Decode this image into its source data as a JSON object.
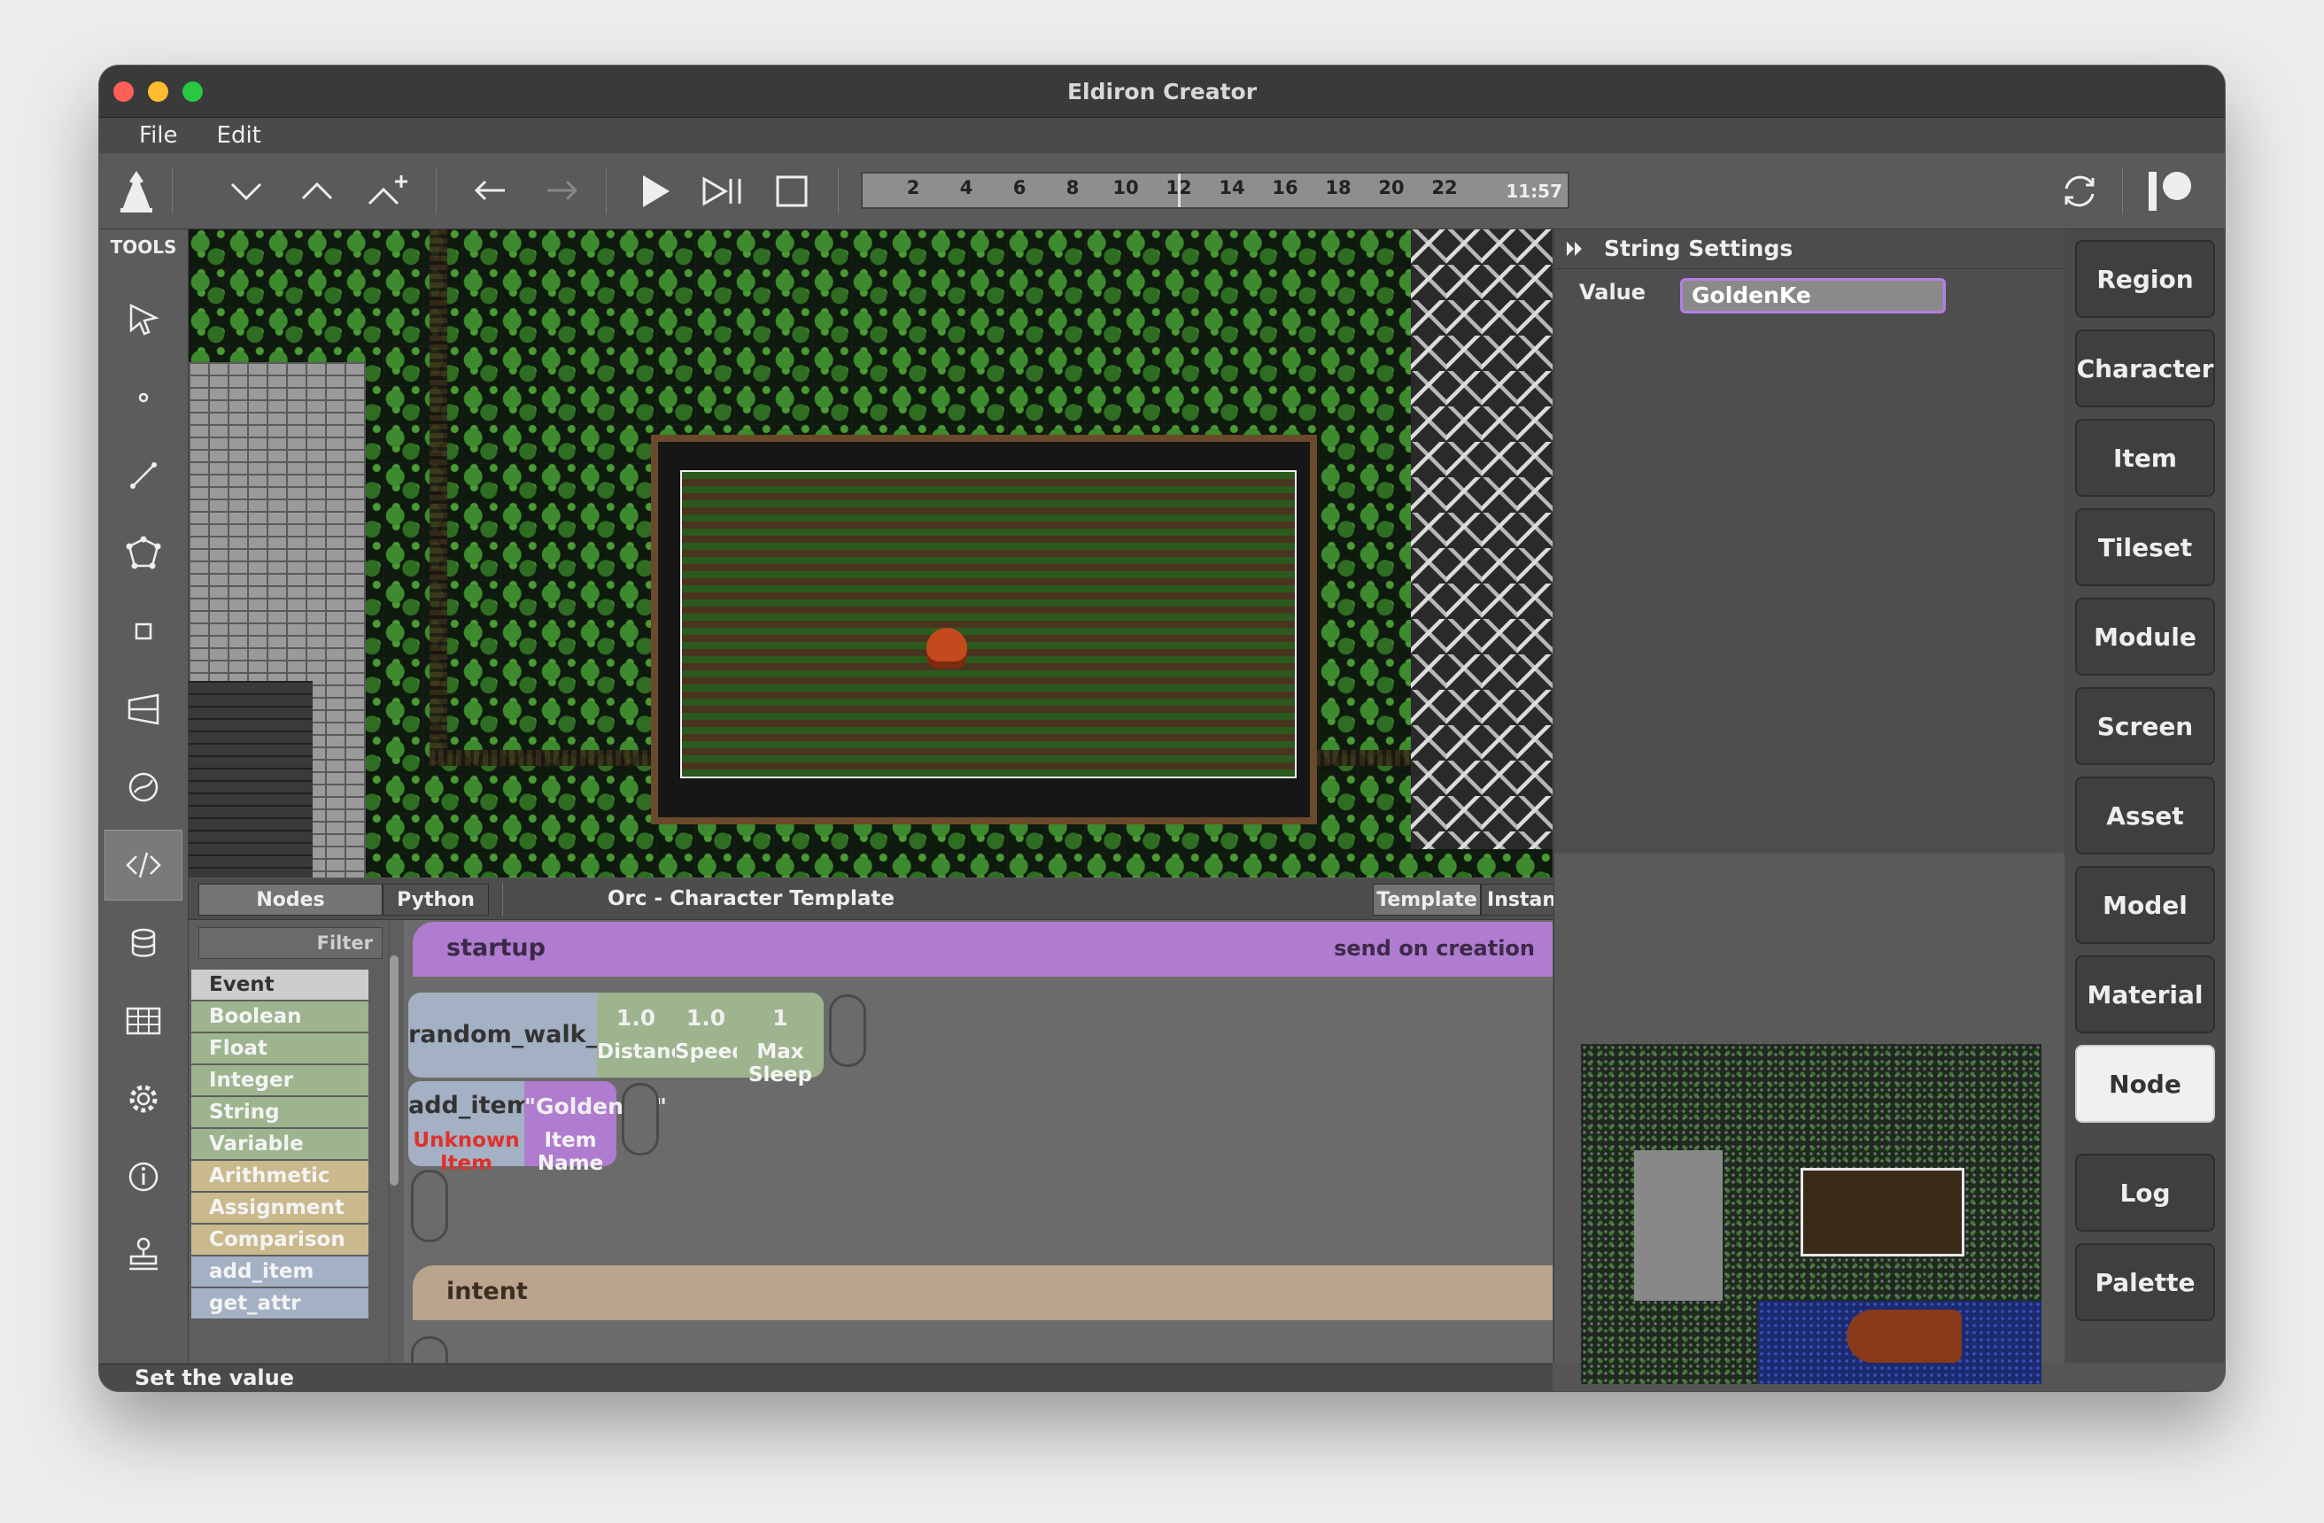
{
  "window": {
    "title": "Eldiron Creator"
  },
  "menu": {
    "items": [
      "File",
      "Edit"
    ]
  },
  "toolbar": {
    "timeline": {
      "ticks": [
        "2",
        "4",
        "6",
        "8",
        "10",
        "12",
        "14",
        "16",
        "18",
        "20",
        "22"
      ],
      "time": "11:57"
    }
  },
  "tools": {
    "title": "TOOLS"
  },
  "bottom": {
    "tabs": {
      "nodes": "Nodes",
      "python": "Python"
    },
    "title": "Orc - Character Template",
    "mode": {
      "template": "Template",
      "instance": "Instance"
    }
  },
  "nodelist": {
    "filter": "Filter",
    "items": [
      "Event",
      "Boolean",
      "Float",
      "Integer",
      "String",
      "Variable",
      "Arithmetic",
      "Assignment",
      "Comparison",
      "add_item",
      "get_attr"
    ]
  },
  "editor": {
    "startup": {
      "label": "startup",
      "hint": "send on creation"
    },
    "random_walk": {
      "name": "random_walk_in_sector",
      "params": [
        {
          "value": "1.0",
          "label": "Distance"
        },
        {
          "value": "1.0",
          "label": "Speed"
        },
        {
          "value": "1",
          "label": "Max Sleep"
        }
      ]
    },
    "add_item": {
      "name": "add_item",
      "error": "Unknown Item",
      "param_value": "\"GoldenKe\"",
      "param_label": "Item Name"
    },
    "intent": {
      "label": "intent"
    }
  },
  "settings": {
    "title": "String Settings",
    "value_label": "Value",
    "value": "GoldenKe"
  },
  "categories": [
    "Region",
    "Character",
    "Item",
    "Tileset",
    "Module",
    "Screen",
    "Asset",
    "Model",
    "Material",
    "Node",
    "Log",
    "Palette"
  ],
  "active_category": "Node",
  "status": {
    "text": "Set the value"
  },
  "colors": {
    "startup_bar": "#b07ccf",
    "intent_bar": "#bba48e",
    "node_block": "#a4b0c3",
    "param_green": "#9db48f",
    "param_purple": "#b07ccf",
    "error_text": "#e0302b"
  }
}
